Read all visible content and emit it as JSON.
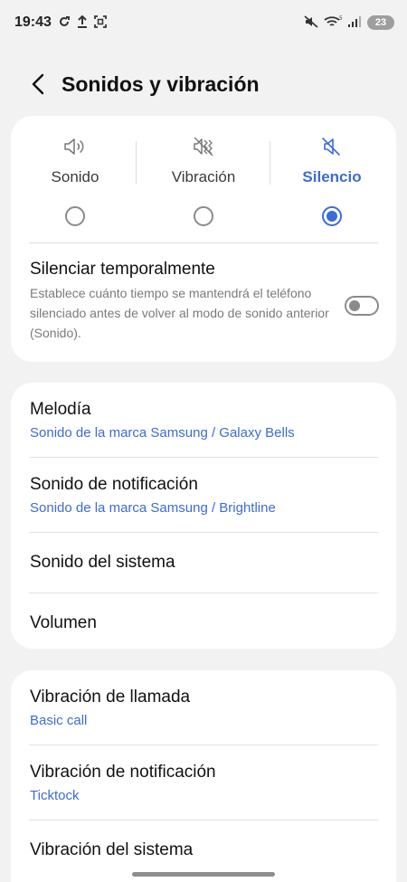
{
  "status": {
    "time": "19:43",
    "battery": "23"
  },
  "header": {
    "title": "Sonidos y vibración"
  },
  "modes": [
    {
      "label": "Sonido",
      "icon": "speaker-icon",
      "selected": false
    },
    {
      "label": "Vibración",
      "icon": "vibrate-icon",
      "selected": false
    },
    {
      "label": "Silencio",
      "icon": "mute-icon",
      "selected": true
    }
  ],
  "mute": {
    "title": "Silenciar temporalmente",
    "description": "Establece cuánto tiempo se mantendrá el teléfono silenciado antes de volver al modo de sonido anterior (Sonido).",
    "enabled": false
  },
  "sounds": {
    "ringtone": {
      "title": "Melodía",
      "value": "Sonido de la marca Samsung / Galaxy Bells"
    },
    "notification": {
      "title": "Sonido de notificación",
      "value": "Sonido de la marca Samsung / Brightline"
    },
    "system": {
      "title": "Sonido del sistema"
    },
    "volume": {
      "title": "Volumen"
    }
  },
  "vibration": {
    "call": {
      "title": "Vibración de llamada",
      "value": "Basic call"
    },
    "notification": {
      "title": "Vibración de notificación",
      "value": "Ticktock"
    },
    "system": {
      "title": "Vibración del sistema"
    }
  },
  "colors": {
    "accent": "#3d6bd6",
    "background": "#f2f2f2",
    "card": "#ffffff"
  }
}
